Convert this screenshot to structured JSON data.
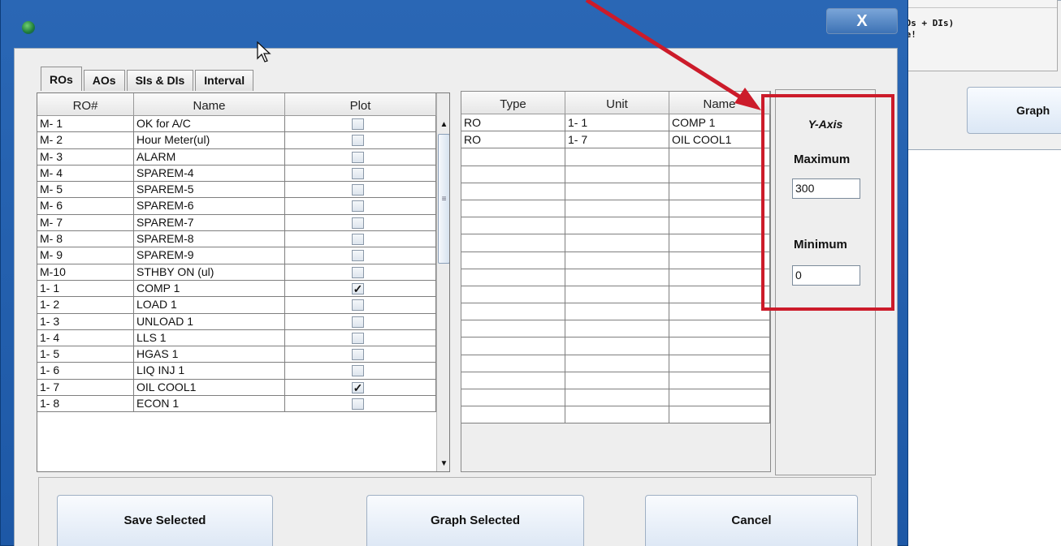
{
  "background_window": {
    "text_lines": [
      "ROs + DIs)",
      "ne!"
    ],
    "graph_button": "Graph"
  },
  "window": {
    "close_glyph": "X"
  },
  "tabs": [
    {
      "label": "ROs",
      "active": true
    },
    {
      "label": "AOs",
      "active": false
    },
    {
      "label": "SIs & DIs",
      "active": false
    },
    {
      "label": "Interval",
      "active": false
    }
  ],
  "ro_table": {
    "headers": [
      "RO#",
      "Name",
      "Plot"
    ],
    "rows": [
      {
        "ro": "M- 1",
        "name": "OK for A/C",
        "plot": false
      },
      {
        "ro": "M- 2",
        "name": "Hour Meter(ul)",
        "plot": false
      },
      {
        "ro": "M- 3",
        "name": "ALARM",
        "plot": false
      },
      {
        "ro": "M- 4",
        "name": "SPAREM-4",
        "plot": false
      },
      {
        "ro": "M- 5",
        "name": "SPAREM-5",
        "plot": false
      },
      {
        "ro": "M- 6",
        "name": "SPAREM-6",
        "plot": false
      },
      {
        "ro": "M- 7",
        "name": "SPAREM-7",
        "plot": false
      },
      {
        "ro": "M- 8",
        "name": "SPAREM-8",
        "plot": false
      },
      {
        "ro": "M- 9",
        "name": "SPAREM-9",
        "plot": false
      },
      {
        "ro": "M-10",
        "name": "STHBY ON  (ul)",
        "plot": false
      },
      {
        "ro": "1- 1",
        "name": "COMP 1",
        "plot": true
      },
      {
        "ro": "1- 2",
        "name": "LOAD 1",
        "plot": false
      },
      {
        "ro": "1- 3",
        "name": "UNLOAD 1",
        "plot": false
      },
      {
        "ro": "1- 4",
        "name": "LLS 1",
        "plot": false
      },
      {
        "ro": "1- 5",
        "name": "HGAS 1",
        "plot": false
      },
      {
        "ro": "1- 6",
        "name": "LIQ INJ 1",
        "plot": false
      },
      {
        "ro": "1- 7",
        "name": "OIL COOL1",
        "plot": true
      },
      {
        "ro": "1- 8",
        "name": "ECON 1",
        "plot": false
      }
    ],
    "check_glyph": "✓"
  },
  "selected_table": {
    "headers": [
      "Type",
      "Unit",
      "Name"
    ],
    "rows": [
      {
        "type": "RO",
        "unit": "1- 1",
        "name": "COMP 1"
      },
      {
        "type": "RO",
        "unit": "1- 7",
        "name": "OIL COOL1"
      },
      {
        "type": "",
        "unit": "",
        "name": ""
      },
      {
        "type": "",
        "unit": "",
        "name": ""
      },
      {
        "type": "",
        "unit": "",
        "name": ""
      },
      {
        "type": "",
        "unit": "",
        "name": ""
      },
      {
        "type": "",
        "unit": "",
        "name": ""
      },
      {
        "type": "",
        "unit": "",
        "name": ""
      },
      {
        "type": "",
        "unit": "",
        "name": ""
      },
      {
        "type": "",
        "unit": "",
        "name": ""
      },
      {
        "type": "",
        "unit": "",
        "name": ""
      },
      {
        "type": "",
        "unit": "",
        "name": ""
      },
      {
        "type": "",
        "unit": "",
        "name": ""
      },
      {
        "type": "",
        "unit": "",
        "name": ""
      },
      {
        "type": "",
        "unit": "",
        "name": ""
      },
      {
        "type": "",
        "unit": "",
        "name": ""
      },
      {
        "type": "",
        "unit": "",
        "name": ""
      },
      {
        "type": "",
        "unit": "",
        "name": ""
      }
    ]
  },
  "y_axis": {
    "title": "Y-Axis",
    "max_label": "Maximum",
    "max_value": "300",
    "min_label": "Minimum",
    "min_value": "0"
  },
  "buttons": {
    "save": "Save Selected",
    "graph": "Graph Selected",
    "cancel": "Cancel"
  },
  "colors": {
    "title_bar": "#1f5fae",
    "highlight": "#cc1b2a"
  },
  "icons": {
    "app": "globe-icon",
    "close": "close-icon",
    "cursor": "mouse-pointer-icon",
    "annotation": "red-arrow"
  }
}
